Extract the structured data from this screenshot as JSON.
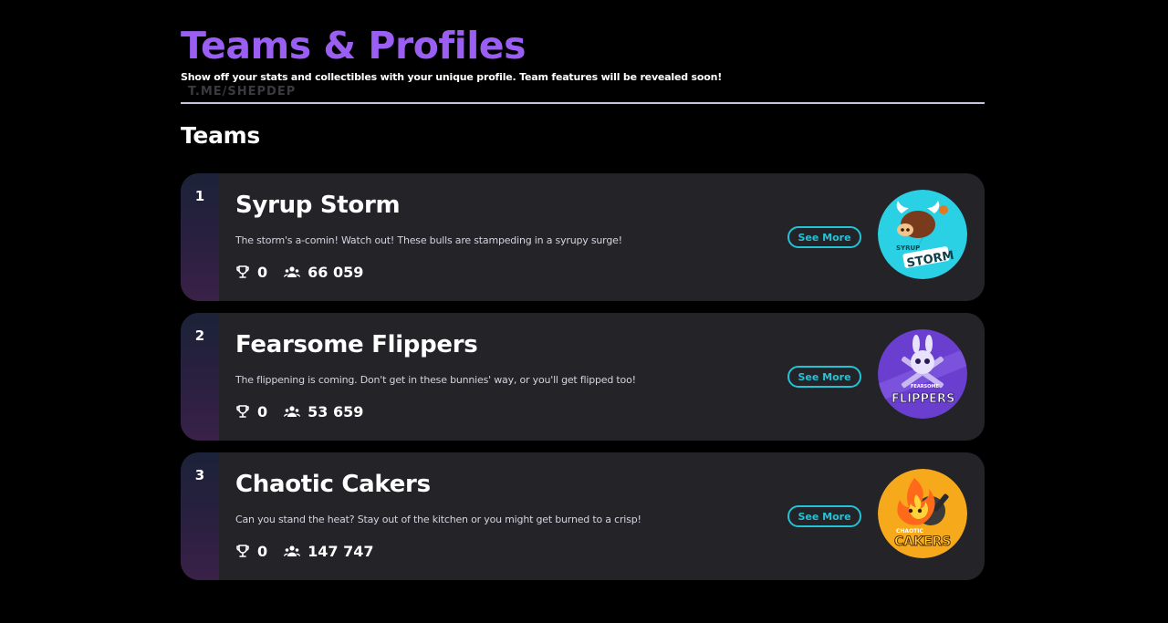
{
  "header": {
    "title": "Teams & Profiles",
    "subtitle": "Show off your stats and collectibles with your unique profile. Team features will be revealed soon!",
    "watermark": "T.ME/SHEPDEP"
  },
  "teams_section": {
    "title": "Teams",
    "see_more_label": "See More",
    "teams": [
      {
        "rank": "1",
        "name": "Syrup Storm",
        "description": "The storm's a-comin! Watch out! These bulls are stampeding in a syrupy surge!",
        "trophies": "0",
        "members": "66 059",
        "logo_top_text": "SYRUP",
        "logo_text": "STORM",
        "logo_color": "#2ad0e3"
      },
      {
        "rank": "2",
        "name": "Fearsome Flippers",
        "description": "The flippening is coming. Don't get in these bunnies' way, or you'll get flipped too!",
        "trophies": "0",
        "members": "53 659",
        "logo_top_text": "FEARSOME",
        "logo_text": "FLIPPERS",
        "logo_color": "#6a3fd0"
      },
      {
        "rank": "3",
        "name": "Chaotic Cakers",
        "description": "Can you stand the heat? Stay out of the kitchen or you might get burned to a crisp!",
        "trophies": "0",
        "members": "147 747",
        "logo_top_text": "CHAOTIC",
        "logo_text": "CAKERS",
        "logo_color": "#f7a91c"
      }
    ]
  },
  "colors": {
    "accent_purple": "#9a5ff2",
    "accent_cyan": "#22c3d6",
    "card_bg": "#232328"
  }
}
